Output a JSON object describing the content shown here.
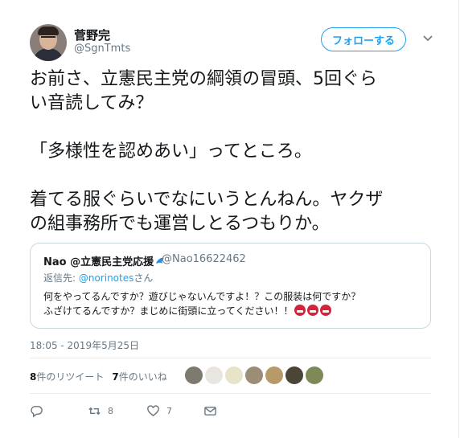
{
  "author": {
    "name": "菅野完",
    "handle": "@SgnTmts"
  },
  "follow_button": "フォローする",
  "tweet": {
    "line1": "お前さ、立憲民主党の綱領の冒頭、5回ぐら",
    "line2": "い音読してみ？",
    "line3": "「多様性を認めあい」ってところ。",
    "line4": "着てる服ぐらいでなにいうとんねん。ヤクザ",
    "line5": "の組事務所でも運営しとるつもりか。"
  },
  "quote": {
    "name": "Nao @立憲民主党応援",
    "handle": "@Nao16622462",
    "reply_prefix": "返信先: ",
    "reply_user": "@norinotes",
    "reply_suffix": "さん",
    "body_line1": "何をやってるんですか？遊びじゃないんですよ！？この服装は何ですか？",
    "body_line2": "ふざけてるんですか？まじめに街頭に立ってください！！"
  },
  "timestamp": "18:05 - 2019年5月25日",
  "stats": {
    "retweet_count": "8",
    "retweet_label": "件のリツイート",
    "like_count": "7",
    "like_label": "件のいいね"
  },
  "actions": {
    "reply_icon": "reply-icon",
    "retweet_icon": "retweet-icon",
    "retweet_count": "8",
    "like_icon": "heart-icon",
    "like_count": "7",
    "dm_icon": "mail-icon"
  },
  "colors": {
    "accent": "#1da1f2",
    "secondary_text": "#657786",
    "border": "#e6ecf0"
  }
}
